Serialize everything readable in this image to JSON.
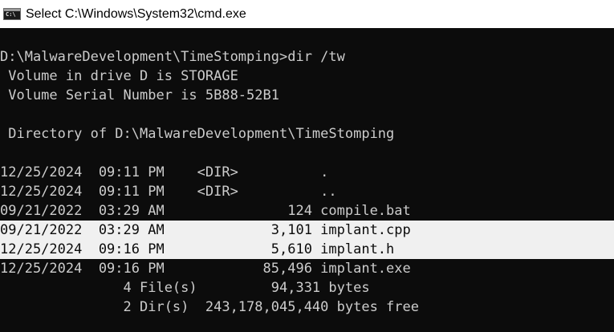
{
  "window": {
    "title": "Select C:\\Windows\\System32\\cmd.exe",
    "icon_name": "cmd-app-icon",
    "icon_text": "C:\\"
  },
  "colors": {
    "background": "#0c0c0c",
    "text": "#cccccc",
    "selection_background": "#f0f0f0",
    "selection_text": "#0c0c0c"
  },
  "console": {
    "lines": [
      {
        "text": "",
        "selected": false
      },
      {
        "text": "D:\\MalwareDevelopment\\TimeStomping>dir /tw",
        "selected": false
      },
      {
        "text": " Volume in drive D is STORAGE",
        "selected": false
      },
      {
        "text": " Volume Serial Number is 5B88-52B1",
        "selected": false
      },
      {
        "text": "",
        "selected": false
      },
      {
        "text": " Directory of D:\\MalwareDevelopment\\TimeStomping",
        "selected": false
      },
      {
        "text": "",
        "selected": false
      },
      {
        "text": "12/25/2024  09:11 PM    <DIR>          .",
        "selected": false
      },
      {
        "text": "12/25/2024  09:11 PM    <DIR>          ..",
        "selected": false
      },
      {
        "text": "09/21/2022  03:29 AM               124 compile.bat",
        "selected": false
      },
      {
        "text": "09/21/2022  03:29 AM             3,101 implant.cpp",
        "selected": true
      },
      {
        "text": "12/25/2024  09:16 PM             5,610 implant.h",
        "selected": true
      },
      {
        "text": "12/25/2024  09:16 PM            85,496 implant.exe",
        "selected": false
      },
      {
        "text": "               4 File(s)         94,331 bytes",
        "selected": false
      },
      {
        "text": "               2 Dir(s)  243,178,045,440 bytes free",
        "selected": false
      }
    ]
  }
}
